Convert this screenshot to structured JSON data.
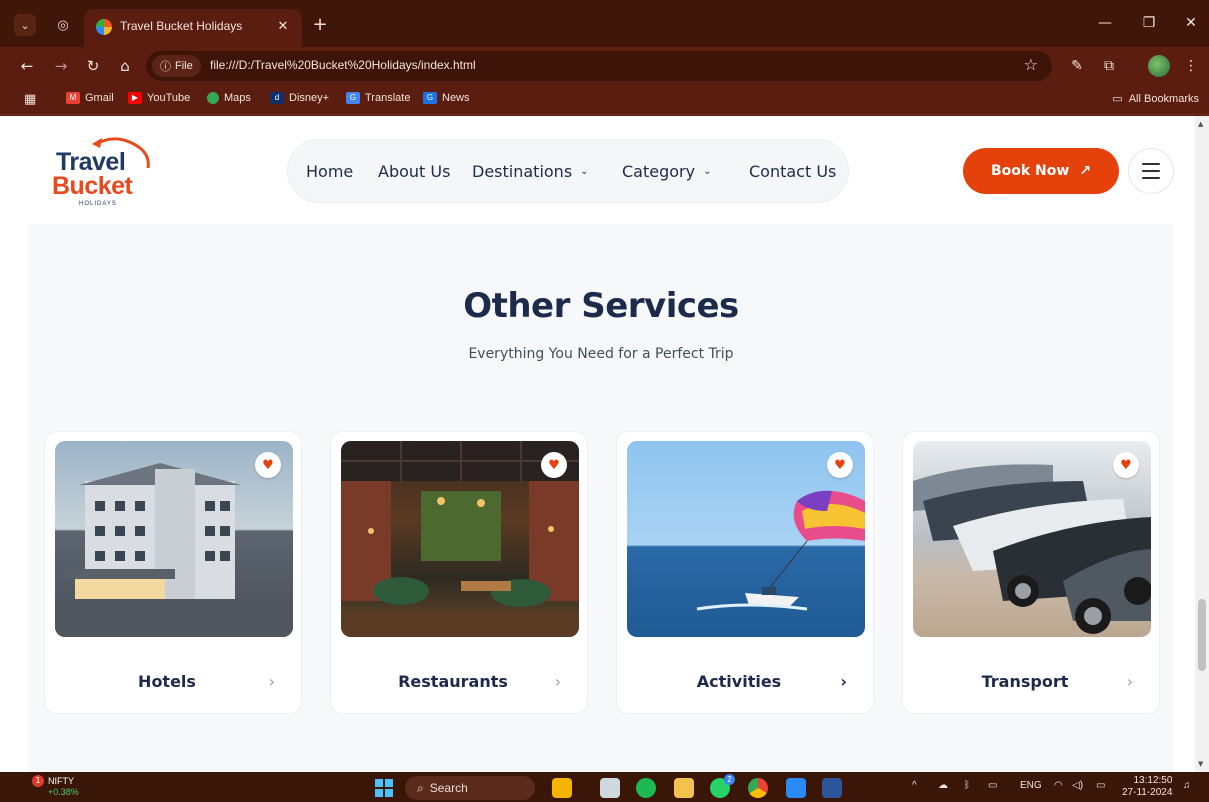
{
  "browser": {
    "tab_title": "Travel Bucket Holidays",
    "file_chip": "File",
    "url": "file:///D:/Travel%20Bucket%20Holidays/index.html",
    "bookmarks": [
      "Gmail",
      "YouTube",
      "Maps",
      "Disney+",
      "Translate",
      "News"
    ],
    "all_bookmarks": "All Bookmarks"
  },
  "header": {
    "logo_line1": "Travel",
    "logo_line2": "Bucket",
    "logo_line3": "HOLIDAYS",
    "nav": {
      "home": "Home",
      "about": "About Us",
      "destinations": "Destinations",
      "category": "Category",
      "contact": "Contact Us"
    },
    "book_now": "Book Now",
    "book_now_arrow": "↗"
  },
  "section": {
    "title": "Other Services",
    "subtitle": "Everything You Need for a Perfect Trip",
    "cards": [
      {
        "label": "Hotels",
        "icon": "hotel-image"
      },
      {
        "label": "Restaurants",
        "icon": "restaurant-image"
      },
      {
        "label": "Activities",
        "icon": "parasailing-image"
      },
      {
        "label": "Transport",
        "icon": "cars-image"
      }
    ]
  },
  "taskbar": {
    "ticker_name": "NIFTY",
    "ticker_change": "+0.38%",
    "ticker_badge": "1",
    "search": "Search",
    "lang": "ENG",
    "time": "13:12:50",
    "date": "27-11-2024",
    "whatsapp_badge": "2"
  },
  "colors": {
    "accent": "#e4410b",
    "heading": "#1d2b4a",
    "chrome": "#5b1d10"
  }
}
